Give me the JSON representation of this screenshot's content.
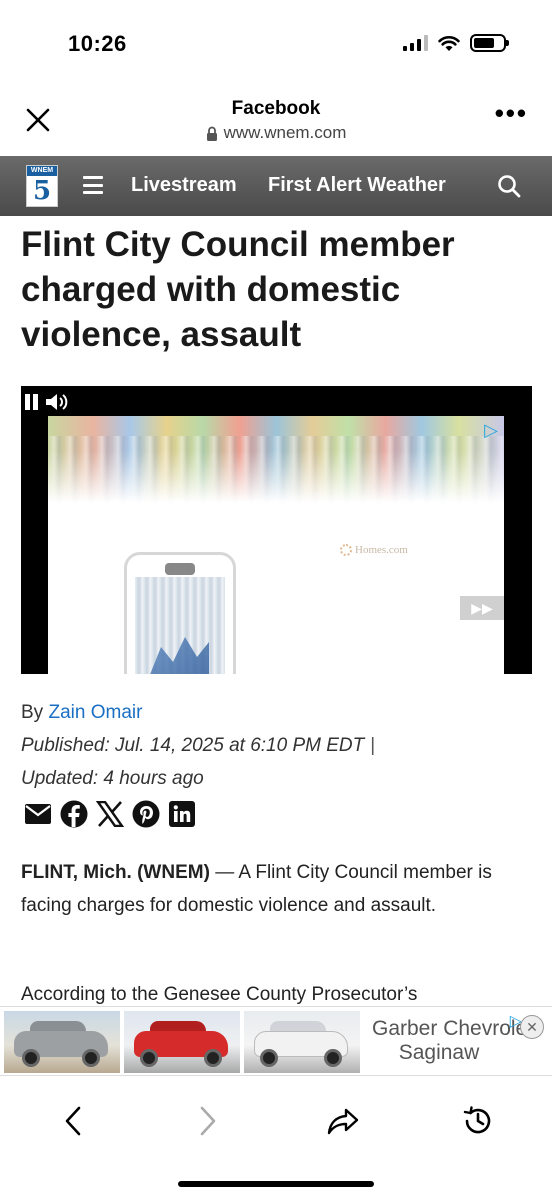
{
  "status_bar": {
    "time": "10:26",
    "icons": [
      "signal-icon",
      "wifi-icon",
      "battery-icon"
    ],
    "battery_level": 0.7
  },
  "browser": {
    "title": "Facebook",
    "url": "www.wnem.com",
    "icons": [
      "close-icon",
      "lock-icon",
      "more-icon"
    ]
  },
  "site_nav": {
    "logo_text": "WNEM",
    "logo_number": "5",
    "items": [
      {
        "label": "Livestream"
      },
      {
        "label": "First Alert Weather"
      }
    ],
    "icons": [
      "menu-icon",
      "search-icon"
    ],
    "background_color": "#555555"
  },
  "article": {
    "headline": "Flint City Council member charged with domestic violence, assault",
    "byline_prefix": "By",
    "author": "Zain Omair",
    "published": "Published: Jul. 14, 2025 at 6:10 PM EDT",
    "separator": "|",
    "updated": "Updated: 4 hours ago",
    "share_icons": [
      "email-icon",
      "facebook-icon",
      "x-icon",
      "pinterest-icon",
      "linkedin-icon"
    ],
    "paragraphs": [
      {
        "dateline": "FLINT, Mich. (WNEM)",
        "text": "— A Flint City Council member is facing charges for domestic violence and assault."
      },
      {
        "dateline": "",
        "text": "According to the Genesee County Prosecutor’s"
      }
    ],
    "link_color": "#1a6fc4"
  },
  "video_ad": {
    "brand": "Homes.com",
    "controls": [
      "pause-icon",
      "volume-icon",
      "adchoices-icon",
      "skip-icon"
    ]
  },
  "bottom_ad": {
    "line1": "Garber Chevrolet",
    "line2": "Saginaw",
    "icons": [
      "adchoices-icon",
      "close-icon"
    ]
  },
  "toolbar": {
    "icons": [
      "back-icon",
      "forward-icon",
      "share-icon",
      "history-icon"
    ]
  }
}
